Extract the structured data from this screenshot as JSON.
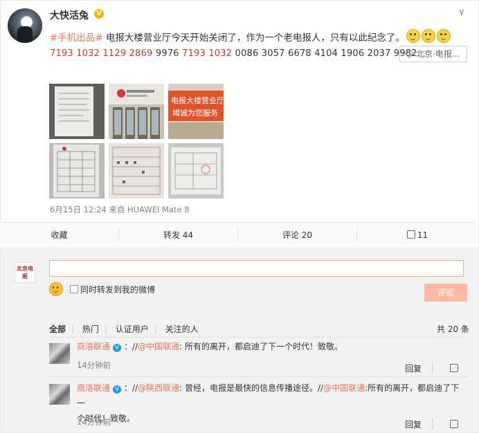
{
  "post": {
    "username": "大快活兔",
    "hashtag": "#手机出品#",
    "text": " 电报大楼营业厅今天开始关闭了，作为一个老电报人，只有以此纪念了。",
    "numbers": [
      {
        "text": "7193 1032 1129 2869",
        "red": true
      },
      {
        "text": " 9976 ",
        "red": false
      },
      {
        "text": "7193 1032",
        "red": true
      },
      {
        "text": " 0086 3057 6678 4104 1906 2037 9982",
        "red": false
      }
    ],
    "location": "北京·电报...",
    "photo_sign_1": "电报大楼营业厅",
    "photo_sign_2": "竭诚为您服务",
    "photo_logo": "中国联通",
    "meta": "6月15日 12:24 来自 HUAWEI Mate 8"
  },
  "actions": {
    "favorite": "收藏",
    "repost": "转发 44",
    "comment": "评论 20",
    "like": "11"
  },
  "compose": {
    "logo_text": "北京电报",
    "input_value": "",
    "checkbox_label": "同时转发到我的微博",
    "submit_label": "评论"
  },
  "filters": {
    "all": "全部",
    "hot": "热门",
    "verified": "认证用户",
    "following": "关注的人",
    "total": "共 20 条"
  },
  "comments": [
    {
      "name": "商洛联通",
      "line1_pre": "：//",
      "mention1": "@中国联通",
      "line1_post": ": 所有的离开，都启迪了下一个时代！致敬。",
      "time": "14分钟前",
      "reply": "回复"
    },
    {
      "name": "商洛联通",
      "line1_pre": "：//",
      "mention1": "@陕西联通",
      "line1_mid": ": 曾经，电报是最快的信息传播途径。//",
      "mention2": "@中国联通",
      "line1_post": ":所有的离开，都启迪了下一",
      "line2": "个时代！致敬。",
      "time": "14分钟前",
      "reply": "回复"
    }
  ]
}
